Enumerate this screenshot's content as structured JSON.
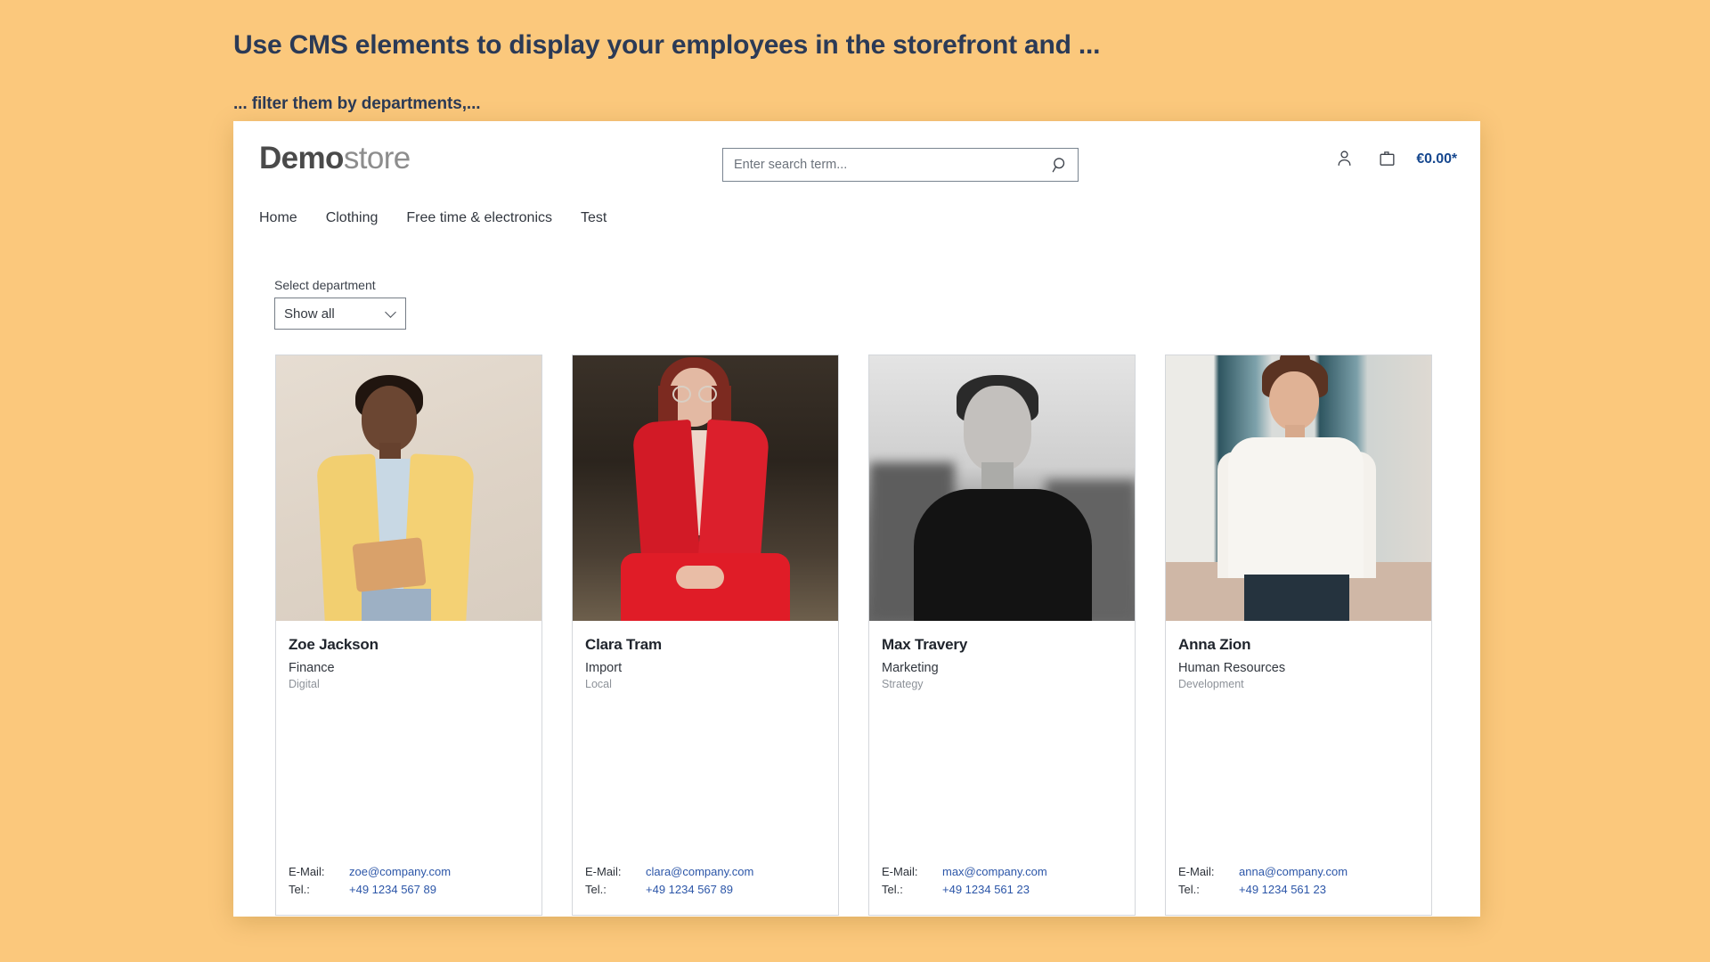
{
  "slide": {
    "headline": "Use CMS elements to display your employees in the storefront and ...",
    "subhead": "... filter them by departments,...",
    "background_color": "#fbc87c",
    "heading_color": "#2b3a56"
  },
  "storefront": {
    "logo": {
      "bold_part": "Demo",
      "light_part": "store"
    },
    "search": {
      "placeholder": "Enter search term...",
      "value": "",
      "icon": "search-icon"
    },
    "header_actions": {
      "account_icon": "person-icon",
      "cart_icon": "shopping-bag-icon",
      "cart_total": "€0.00*",
      "cart_total_color": "#17488f"
    },
    "nav": [
      {
        "label": "Home"
      },
      {
        "label": "Clothing"
      },
      {
        "label": "Free time & electronics"
      },
      {
        "label": "Test"
      }
    ],
    "filter": {
      "label": "Select department",
      "selected": "Show all",
      "chevron_icon": "chevron-down-icon"
    },
    "contact_labels": {
      "email": "E-Mail:",
      "phone": "Tel.:"
    },
    "link_color": "#2c56a8",
    "employees": [
      {
        "name": "Zoe Jackson",
        "department": "Finance",
        "subdepartment": "Digital",
        "email": "zoe@company.com",
        "phone": "+49 1234 567 89",
        "photo_alt": "woman-in-yellow-blazer"
      },
      {
        "name": "Clara Tram",
        "department": "Import",
        "subdepartment": "Local",
        "email": "clara@company.com",
        "phone": "+49 1234 567 89",
        "photo_alt": "woman-in-red-suit"
      },
      {
        "name": "Max Travery",
        "department": "Marketing",
        "subdepartment": "Strategy",
        "email": "max@company.com",
        "phone": "+49 1234 561 23",
        "photo_alt": "man-black-and-white-portrait"
      },
      {
        "name": "Anna Zion",
        "department": "Human Resources",
        "subdepartment": "Development",
        "email": "anna@company.com",
        "phone": "+49 1234 561 23",
        "photo_alt": "woman-in-white-blouse"
      }
    ]
  }
}
